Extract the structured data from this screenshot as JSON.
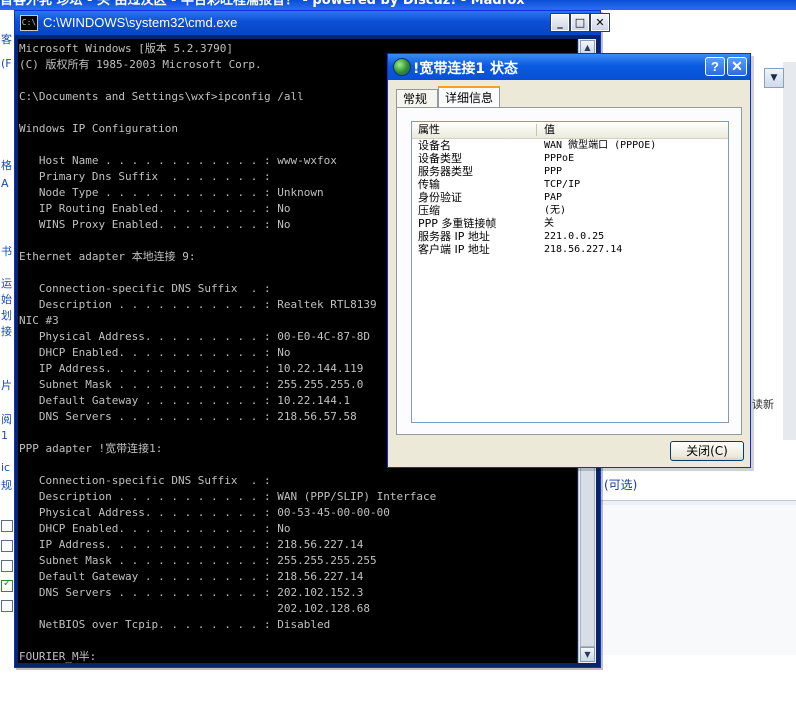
{
  "background_page": {
    "title_fragment": "首客外乳 珍坛 - 头 由过汶区 - 半台彩旺程濡报音！ - powered by Discuz! - Madfox",
    "left_strip_fragments": [
      "客",
      "(F",
      "格",
      "A",
      "书",
      "运",
      "始",
      "划",
      "接",
      "片",
      "阅",
      "1",
      "ic",
      "规"
    ],
    "optional_label": "(可选)",
    "right_fragment": "读新",
    "dropdown_glyph": "▼"
  },
  "cmd_window": {
    "title": "C:\\WINDOWS\\system32\\cmd.exe",
    "icon_label": "C:\\",
    "buttons": {
      "minimize": "_",
      "maximize": "□",
      "close": "✕"
    },
    "console_lines": [
      "Microsoft Windows [版本 5.2.3790]",
      "(C) 版权所有 1985-2003 Microsoft Corp.",
      "",
      "C:\\Documents and Settings\\wxf>ipconfig /all",
      "",
      "Windows IP Configuration",
      "",
      "   Host Name . . . . . . . . . . . . : www-wxfox",
      "   Primary Dns Suffix  . . . . . . . :",
      "   Node Type . . . . . . . . . . . . : Unknown",
      "   IP Routing Enabled. . . . . . . . : No",
      "   WINS Proxy Enabled. . . . . . . . : No",
      "",
      "Ethernet adapter 本地连接 9:",
      "",
      "   Connection-specific DNS Suffix  . :",
      "   Description . . . . . . . . . . . : Realtek RTL8139",
      "NIC #3",
      "   Physical Address. . . . . . . . . : 00-E0-4C-87-8D",
      "   DHCP Enabled. . . . . . . . . . . : No",
      "   IP Address. . . . . . . . . . . . : 10.22.144.119",
      "   Subnet Mask . . . . . . . . . . . : 255.255.255.0",
      "   Default Gateway . . . . . . . . . : 10.22.144.1",
      "   DNS Servers . . . . . . . . . . . : 218.56.57.58",
      "",
      "PPP adapter !宽带连接1:",
      "",
      "   Connection-specific DNS Suffix  . :",
      "   Description . . . . . . . . . . . : WAN (PPP/SLIP) Interface",
      "   Physical Address. . . . . . . . . : 00-53-45-00-00-00",
      "   DHCP Enabled. . . . . . . . . . . : No",
      "   IP Address. . . . . . . . . . . . : 218.56.227.14",
      "   Subnet Mask . . . . . . . . . . . : 255.255.255.255",
      "   Default Gateway . . . . . . . . . : 218.56.227.14",
      "   DNS Servers . . . . . . . . . . . : 202.102.152.3",
      "                                       202.102.128.68",
      "   NetBIOS over Tcpip. . . . . . . . : Disabled",
      "",
      "FOURIER_M半:"
    ]
  },
  "status_dialog": {
    "title": "!宽带连接1 状态",
    "help_button": "?",
    "close_x": "✕",
    "tabs": [
      {
        "label": "常规",
        "active": false
      },
      {
        "label": "详细信息",
        "active": true
      }
    ],
    "columns": {
      "property": "属性",
      "value": "值"
    },
    "rows": [
      {
        "key": "设备名",
        "value": "WAN 微型端口 (PPPOE)"
      },
      {
        "key": "设备类型",
        "value": "PPPoE"
      },
      {
        "key": "服务器类型",
        "value": "PPP"
      },
      {
        "key": "传输",
        "value": "TCP/IP"
      },
      {
        "key": "身份验证",
        "value": "PAP"
      },
      {
        "key": "压缩",
        "value": "(无)"
      },
      {
        "key": "PPP 多重链接帧",
        "value": "关"
      },
      {
        "key": "服务器 IP 地址",
        "value": "221.0.0.25"
      },
      {
        "key": "客户端 IP 地址",
        "value": "218.56.227.14"
      }
    ],
    "close_button": "关闭(C)"
  }
}
